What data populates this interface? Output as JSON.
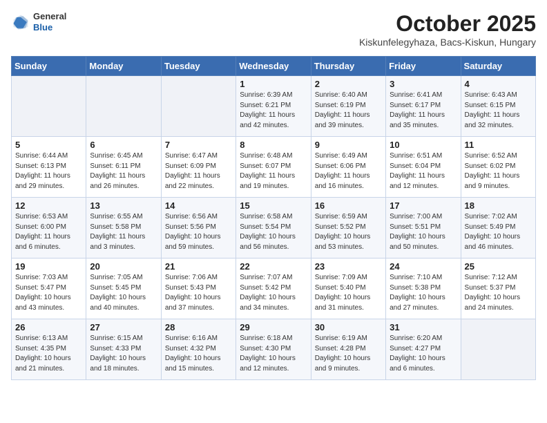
{
  "header": {
    "logo": {
      "general": "General",
      "blue": "Blue"
    },
    "title": "October 2025",
    "location": "Kiskunfelegyhaza, Bacs-Kiskun, Hungary"
  },
  "days_of_week": [
    "Sunday",
    "Monday",
    "Tuesday",
    "Wednesday",
    "Thursday",
    "Friday",
    "Saturday"
  ],
  "weeks": [
    [
      {
        "day": "",
        "info": ""
      },
      {
        "day": "",
        "info": ""
      },
      {
        "day": "",
        "info": ""
      },
      {
        "day": "1",
        "info": "Sunrise: 6:39 AM\nSunset: 6:21 PM\nDaylight: 11 hours\nand 42 minutes."
      },
      {
        "day": "2",
        "info": "Sunrise: 6:40 AM\nSunset: 6:19 PM\nDaylight: 11 hours\nand 39 minutes."
      },
      {
        "day": "3",
        "info": "Sunrise: 6:41 AM\nSunset: 6:17 PM\nDaylight: 11 hours\nand 35 minutes."
      },
      {
        "day": "4",
        "info": "Sunrise: 6:43 AM\nSunset: 6:15 PM\nDaylight: 11 hours\nand 32 minutes."
      }
    ],
    [
      {
        "day": "5",
        "info": "Sunrise: 6:44 AM\nSunset: 6:13 PM\nDaylight: 11 hours\nand 29 minutes."
      },
      {
        "day": "6",
        "info": "Sunrise: 6:45 AM\nSunset: 6:11 PM\nDaylight: 11 hours\nand 26 minutes."
      },
      {
        "day": "7",
        "info": "Sunrise: 6:47 AM\nSunset: 6:09 PM\nDaylight: 11 hours\nand 22 minutes."
      },
      {
        "day": "8",
        "info": "Sunrise: 6:48 AM\nSunset: 6:07 PM\nDaylight: 11 hours\nand 19 minutes."
      },
      {
        "day": "9",
        "info": "Sunrise: 6:49 AM\nSunset: 6:06 PM\nDaylight: 11 hours\nand 16 minutes."
      },
      {
        "day": "10",
        "info": "Sunrise: 6:51 AM\nSunset: 6:04 PM\nDaylight: 11 hours\nand 12 minutes."
      },
      {
        "day": "11",
        "info": "Sunrise: 6:52 AM\nSunset: 6:02 PM\nDaylight: 11 hours\nand 9 minutes."
      }
    ],
    [
      {
        "day": "12",
        "info": "Sunrise: 6:53 AM\nSunset: 6:00 PM\nDaylight: 11 hours\nand 6 minutes."
      },
      {
        "day": "13",
        "info": "Sunrise: 6:55 AM\nSunset: 5:58 PM\nDaylight: 11 hours\nand 3 minutes."
      },
      {
        "day": "14",
        "info": "Sunrise: 6:56 AM\nSunset: 5:56 PM\nDaylight: 10 hours\nand 59 minutes."
      },
      {
        "day": "15",
        "info": "Sunrise: 6:58 AM\nSunset: 5:54 PM\nDaylight: 10 hours\nand 56 minutes."
      },
      {
        "day": "16",
        "info": "Sunrise: 6:59 AM\nSunset: 5:52 PM\nDaylight: 10 hours\nand 53 minutes."
      },
      {
        "day": "17",
        "info": "Sunrise: 7:00 AM\nSunset: 5:51 PM\nDaylight: 10 hours\nand 50 minutes."
      },
      {
        "day": "18",
        "info": "Sunrise: 7:02 AM\nSunset: 5:49 PM\nDaylight: 10 hours\nand 46 minutes."
      }
    ],
    [
      {
        "day": "19",
        "info": "Sunrise: 7:03 AM\nSunset: 5:47 PM\nDaylight: 10 hours\nand 43 minutes."
      },
      {
        "day": "20",
        "info": "Sunrise: 7:05 AM\nSunset: 5:45 PM\nDaylight: 10 hours\nand 40 minutes."
      },
      {
        "day": "21",
        "info": "Sunrise: 7:06 AM\nSunset: 5:43 PM\nDaylight: 10 hours\nand 37 minutes."
      },
      {
        "day": "22",
        "info": "Sunrise: 7:07 AM\nSunset: 5:42 PM\nDaylight: 10 hours\nand 34 minutes."
      },
      {
        "day": "23",
        "info": "Sunrise: 7:09 AM\nSunset: 5:40 PM\nDaylight: 10 hours\nand 31 minutes."
      },
      {
        "day": "24",
        "info": "Sunrise: 7:10 AM\nSunset: 5:38 PM\nDaylight: 10 hours\nand 27 minutes."
      },
      {
        "day": "25",
        "info": "Sunrise: 7:12 AM\nSunset: 5:37 PM\nDaylight: 10 hours\nand 24 minutes."
      }
    ],
    [
      {
        "day": "26",
        "info": "Sunrise: 6:13 AM\nSunset: 4:35 PM\nDaylight: 10 hours\nand 21 minutes."
      },
      {
        "day": "27",
        "info": "Sunrise: 6:15 AM\nSunset: 4:33 PM\nDaylight: 10 hours\nand 18 minutes."
      },
      {
        "day": "28",
        "info": "Sunrise: 6:16 AM\nSunset: 4:32 PM\nDaylight: 10 hours\nand 15 minutes."
      },
      {
        "day": "29",
        "info": "Sunrise: 6:18 AM\nSunset: 4:30 PM\nDaylight: 10 hours\nand 12 minutes."
      },
      {
        "day": "30",
        "info": "Sunrise: 6:19 AM\nSunset: 4:28 PM\nDaylight: 10 hours\nand 9 minutes."
      },
      {
        "day": "31",
        "info": "Sunrise: 6:20 AM\nSunset: 4:27 PM\nDaylight: 10 hours\nand 6 minutes."
      },
      {
        "day": "",
        "info": ""
      }
    ]
  ]
}
